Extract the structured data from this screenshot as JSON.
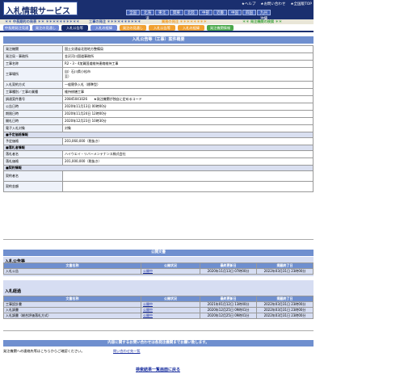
{
  "app": {
    "title": "入札情報サービス",
    "top_links": [
      "ヘルプ",
      "お問い合わせ",
      "全国版TOP"
    ],
    "regions": [
      "全国",
      "北海道",
      "東北",
      "関東",
      "北陸",
      "中部",
      "近畿",
      "中国",
      "四国",
      "九州沖縄"
    ]
  },
  "categories": [
    "中長期的の発表",
    "工事の発注",
    "業務の発注",
    "発注機関の検索"
  ],
  "tabs": [
    {
      "label": "中長期発注見通し",
      "style": "b"
    },
    {
      "label": "発注の見通し",
      "style": "b"
    },
    {
      "label": "入札公告等",
      "style": "active"
    },
    {
      "label": "入札の経緯",
      "style": "b"
    },
    {
      "label": "発注の見通し",
      "style": "o"
    },
    {
      "label": "入札公告等",
      "style": "o"
    },
    {
      "label": "入札の経緯",
      "style": "o"
    },
    {
      "label": "発注機関情報",
      "style": "g"
    }
  ],
  "main": {
    "title": "入札公告等（工事）案件概要",
    "rows": [
      {
        "label": "発注機関",
        "value": "国土交通省北陸地方整備局"
      },
      {
        "label": "発注局・事務所",
        "value": "金沢河川国道事務所"
      },
      {
        "label": "工事名称",
        "value": "R2・3・4加賀国道維持連絡維持工事"
      },
      {
        "label": "工事場所",
        "value": "自）石川県小松市\n至）"
      },
      {
        "label": "入札契約方式",
        "value": "一般競争入札（標準型）"
      },
      {
        "label": "工事種別／工事の業種",
        "value": "維持修繕工事"
      },
      {
        "label": "調達案件番号",
        "value": "20845041026　　★発注機関が独自に定めるコード"
      },
      {
        "label": "公告日時",
        "value": "2020年11月13日 00時00分"
      },
      {
        "label": "期限日時",
        "value": "2020年11月24日 12時00分"
      },
      {
        "label": "開札日時",
        "value": "2020年12月23日 10時30分"
      },
      {
        "label": "電子入札対象",
        "value": "対象"
      }
    ],
    "price_section": "■予定価格情報",
    "price_rows": [
      {
        "label": "予定価格",
        "value": "203,060,000（税抜き）"
      }
    ],
    "award_section": "■落札者情報",
    "award_rows": [
      {
        "label": "落札者名",
        "value": "ハイウエイ・リバーメンテナンス株式会社"
      },
      {
        "label": "落札価格",
        "value": "201,000,000（税抜き）"
      }
    ],
    "contract_section": "■契約情報",
    "contract_rows": [
      {
        "label": "契約者名",
        "value": ""
      },
      {
        "label": "契約金額",
        "value": ""
      }
    ]
  },
  "documents": {
    "title": "公開文書",
    "notice_title": "入札公告等",
    "bidding_title": "入札経過",
    "headers": [
      "文書名称",
      "公開状況",
      "最終更新日",
      "掲載終了日"
    ],
    "notice_rows": [
      {
        "name": "入札公告",
        "status": "公開中",
        "updated": "2020年11月13日 07時00分",
        "end": "2022年03月31日 23時00分"
      }
    ],
    "bidding_rows": [
      {
        "name": "工事設計書",
        "status": "公開中",
        "updated": "2021年01月12日 13時40分",
        "end": "2022年03月31日 23時00分"
      },
      {
        "name": "入札調書",
        "status": "公開中",
        "updated": "2020年12月25日 09時41分",
        "end": "2022年03月31日 23時00分"
      },
      {
        "name": "入札調書（総合評価落札方式）",
        "status": "公開中",
        "updated": "2020年12月25日 09時41分",
        "end": "2022年03月31日 23時00分"
      }
    ]
  },
  "contact": {
    "bar": "内容に関するお問い合わせは各発注機関までお願い致します。",
    "text": "発注機関への連絡先等はこちらからご確認ください。",
    "link": "問い合わせ先一覧"
  },
  "back_link": "検索結果一覧画面に戻る"
}
